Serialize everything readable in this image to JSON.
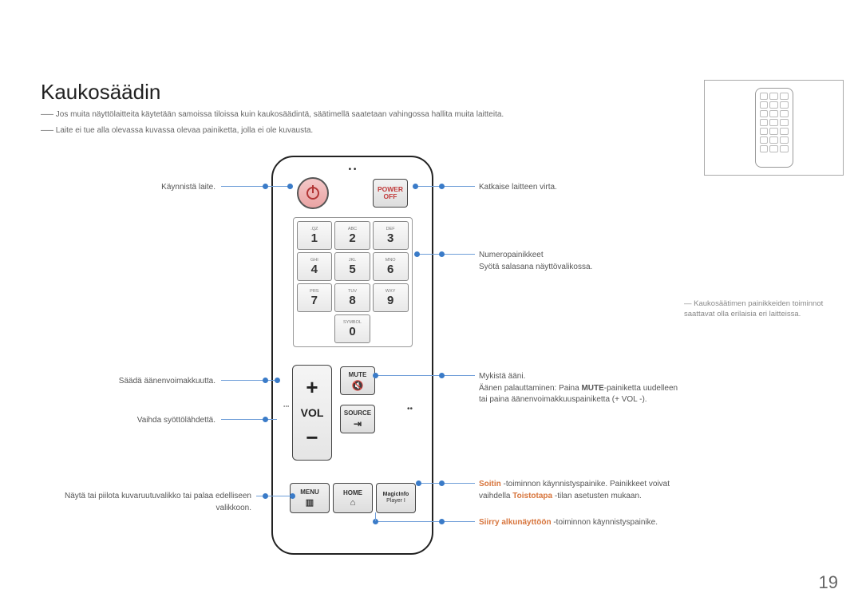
{
  "title": "Kaukosäädin",
  "notes": {
    "n1": "Jos muita näyttölaitteita käytetään samoissa tiloissa kuin kaukosäädintä, säätimellä saatetaan vahingossa hallita muita laitteita.",
    "n2": "Laite ei tue alla olevassa kuvassa olevaa painiketta, jolla ei ole kuvausta."
  },
  "buttons": {
    "power_off_a": "POWER",
    "power_off_b": "OFF",
    "mute": "MUTE",
    "source": "SOURCE",
    "vol": "VOL",
    "menu": "MENU",
    "home": "HOME",
    "magicinfo": "MagicInfo",
    "player": "Player I"
  },
  "keypad": [
    {
      "num": "1",
      "sub": ".QZ"
    },
    {
      "num": "2",
      "sub": "ABC"
    },
    {
      "num": "3",
      "sub": "DEF"
    },
    {
      "num": "4",
      "sub": "GHI"
    },
    {
      "num": "5",
      "sub": "JKL"
    },
    {
      "num": "6",
      "sub": "MNO"
    },
    {
      "num": "7",
      "sub": "PRS"
    },
    {
      "num": "8",
      "sub": "TUV"
    },
    {
      "num": "9",
      "sub": "WXY"
    },
    {
      "num": "0",
      "sub": "SYMBOL"
    }
  ],
  "callouts": {
    "left1": "Käynnistä laite.",
    "left2": "Säädä äänenvoimakkuutta.",
    "left3": "Vaihda syöttölähdettä.",
    "left4": "Näytä tai piilota kuvaruutuvalikko tai palaa edelliseen valikkoon.",
    "right1": "Katkaise laitteen virta.",
    "right2a": "Numeropainikkeet",
    "right2b": "Syötä salasana näyttövalikossa.",
    "right3a": "Mykistä ääni.",
    "right3b_pre": "Äänen palauttaminen: Paina ",
    "right3b_bold": "MUTE",
    "right3b_post": "-painiketta uudelleen tai paina äänenvoimakkuuspainiketta (+ VOL -).",
    "right4_w1": "Soitin",
    "right4_mid": " -toiminnon käynnistyspainike. Painikkeet voivat vaihdella ",
    "right4_w2": "Toistotapa",
    "right4_end": " -tilan asetusten mukaan.",
    "right5_w": "Siirry alkunäyttöön",
    "right5_post": " -toiminnon käynnistyspainike."
  },
  "sidebar_note": "―  Kaukosäätimen painikkeiden toiminnot saattavat olla erilaisia eri laitteissa.",
  "page_number": "19"
}
